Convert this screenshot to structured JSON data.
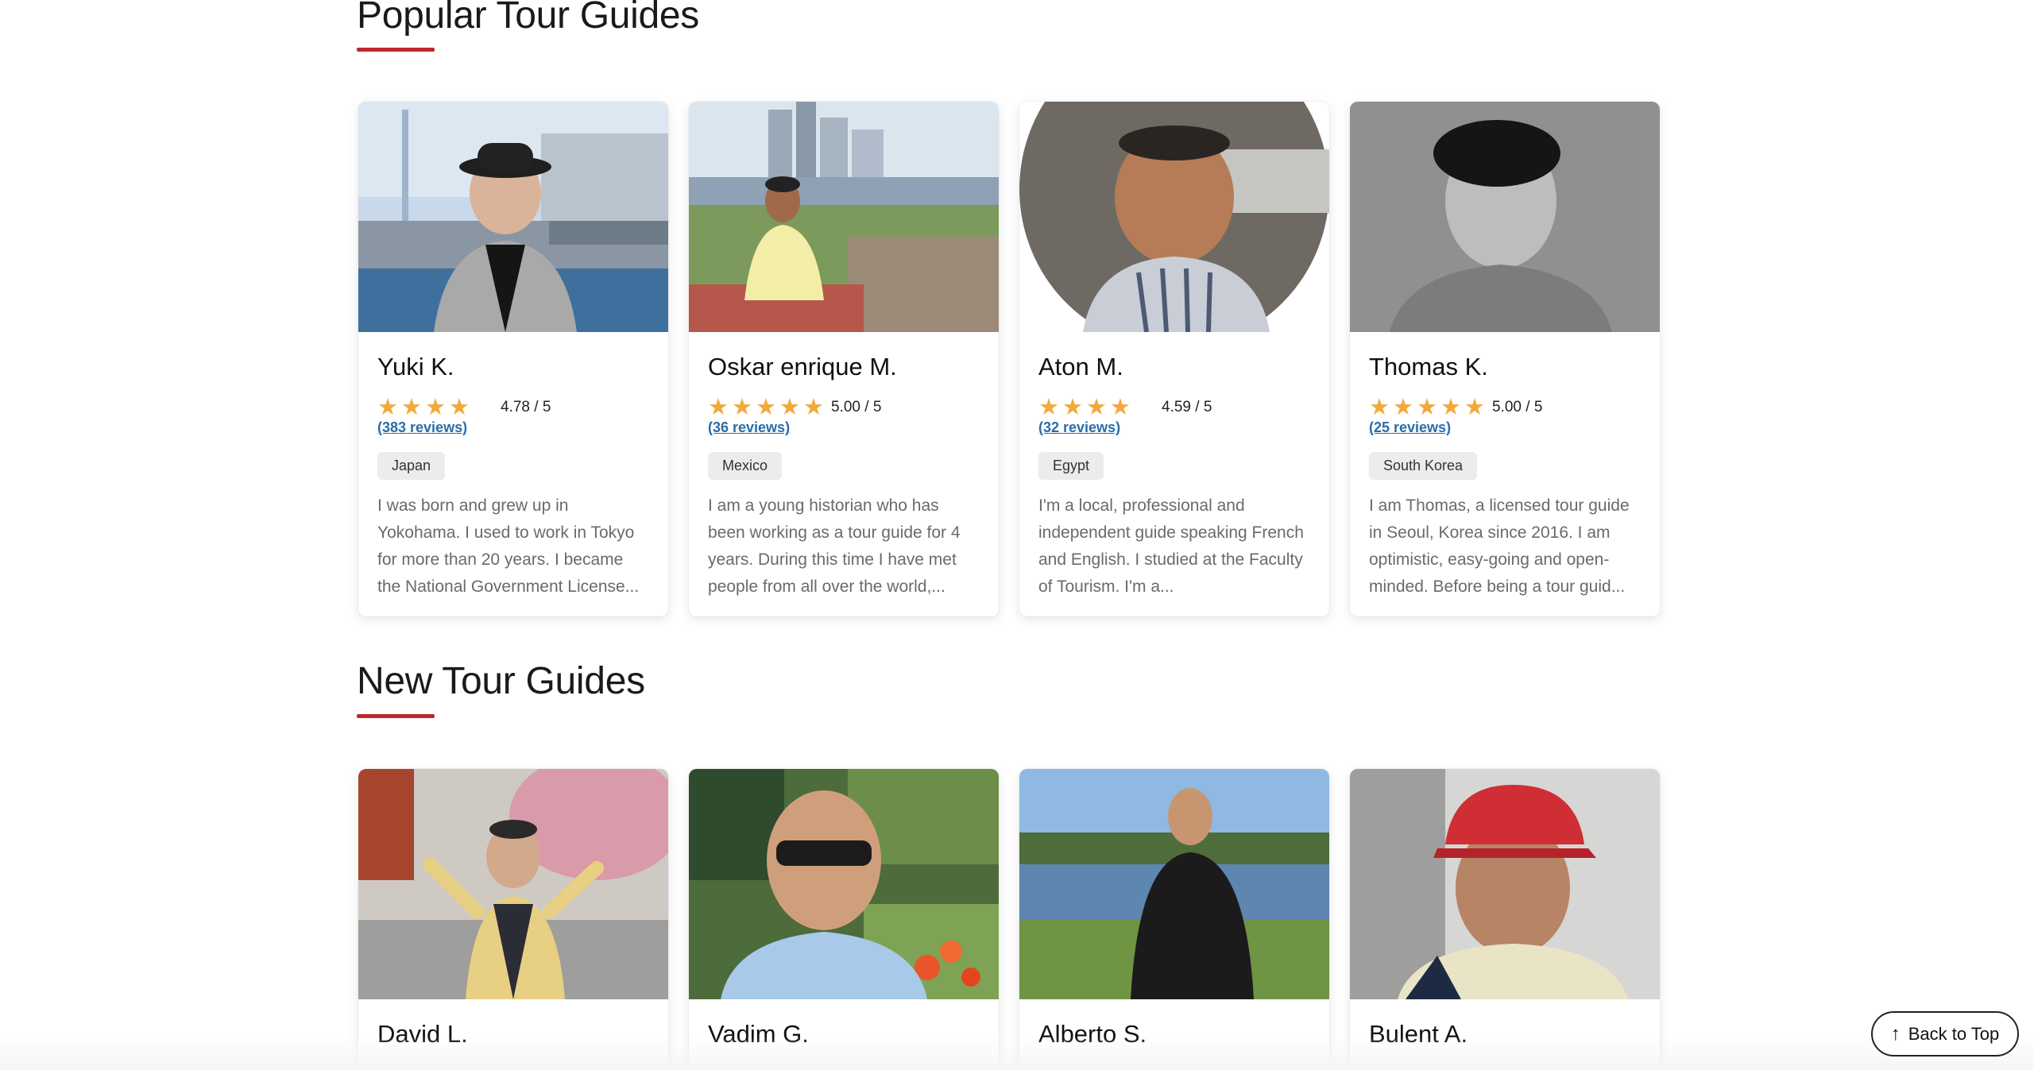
{
  "sections": {
    "popular_title": "Popular Tour Guides",
    "new_title": "New Tour Guides"
  },
  "popular_guides": [
    {
      "name": "Yuki K.",
      "rating": "4.78 / 5",
      "stars": 4,
      "reviews": "(383 reviews)",
      "country": "Japan",
      "bio": "I was born and grew up in Yokohama. I used to work in Tokyo for more than 20 years. I became the National Government License..."
    },
    {
      "name": "Oskar enrique M.",
      "rating": "5.00 / 5",
      "stars": 5,
      "reviews": "(36 reviews)",
      "country": "Mexico",
      "bio": "I am a young historian who has been working as a tour guide for 4 years. During this time I have met people from all over the world,..."
    },
    {
      "name": "Aton M.",
      "rating": "4.59 / 5",
      "stars": 4,
      "reviews": "(32 reviews)",
      "country": "Egypt",
      "bio": "I'm a local, professional and independent guide speaking French and English.  I studied at the Faculty of Tourism. I'm a..."
    },
    {
      "name": "Thomas K.",
      "rating": "5.00 / 5",
      "stars": 5,
      "reviews": "(25 reviews)",
      "country": "South Korea",
      "bio": "I am Thomas, a licensed tour guide in Seoul, Korea since 2016. I am optimistic, easy-going and open-minded. Before being a tour guid..."
    }
  ],
  "new_guides": [
    {
      "name": "David L."
    },
    {
      "name": "Vadim G."
    },
    {
      "name": "Alberto S."
    },
    {
      "name": "Bulent A."
    }
  ],
  "star_glyph": "★",
  "back_to_top": {
    "label": "Back to Top",
    "icon": "arrow-up-icon"
  },
  "colors": {
    "accent_underline": "#c0262d",
    "star": "#f2a93b",
    "review_link": "#2a6ca8",
    "tag_bg": "#ececec"
  }
}
